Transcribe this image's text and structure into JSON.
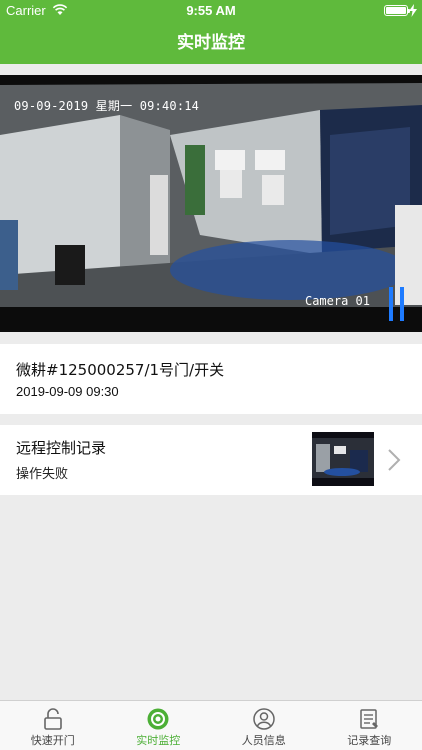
{
  "status_bar": {
    "carrier": "Carrier",
    "time": "9:55 AM"
  },
  "nav": {
    "title": "实时监控"
  },
  "video": {
    "osd_datetime": "09-09-2019 星期一 09:40:14",
    "camera_label": "Camera 01"
  },
  "device": {
    "name": "微耕#125000257/1号门/开关",
    "datetime": "2019-09-09 09:30"
  },
  "record": {
    "title": "远程控制记录",
    "status": "操作失败"
  },
  "tabs": [
    {
      "label": "快速开门",
      "icon": "lock-icon"
    },
    {
      "label": "实时监控",
      "icon": "monitor-icon",
      "active": true
    },
    {
      "label": "人员信息",
      "icon": "person-icon"
    },
    {
      "label": "记录查询",
      "icon": "document-icon"
    }
  ],
  "colors": {
    "brand_green": "#5fba3c",
    "active_tab": "#4caf36",
    "pause_blue": "#1e7bff"
  }
}
